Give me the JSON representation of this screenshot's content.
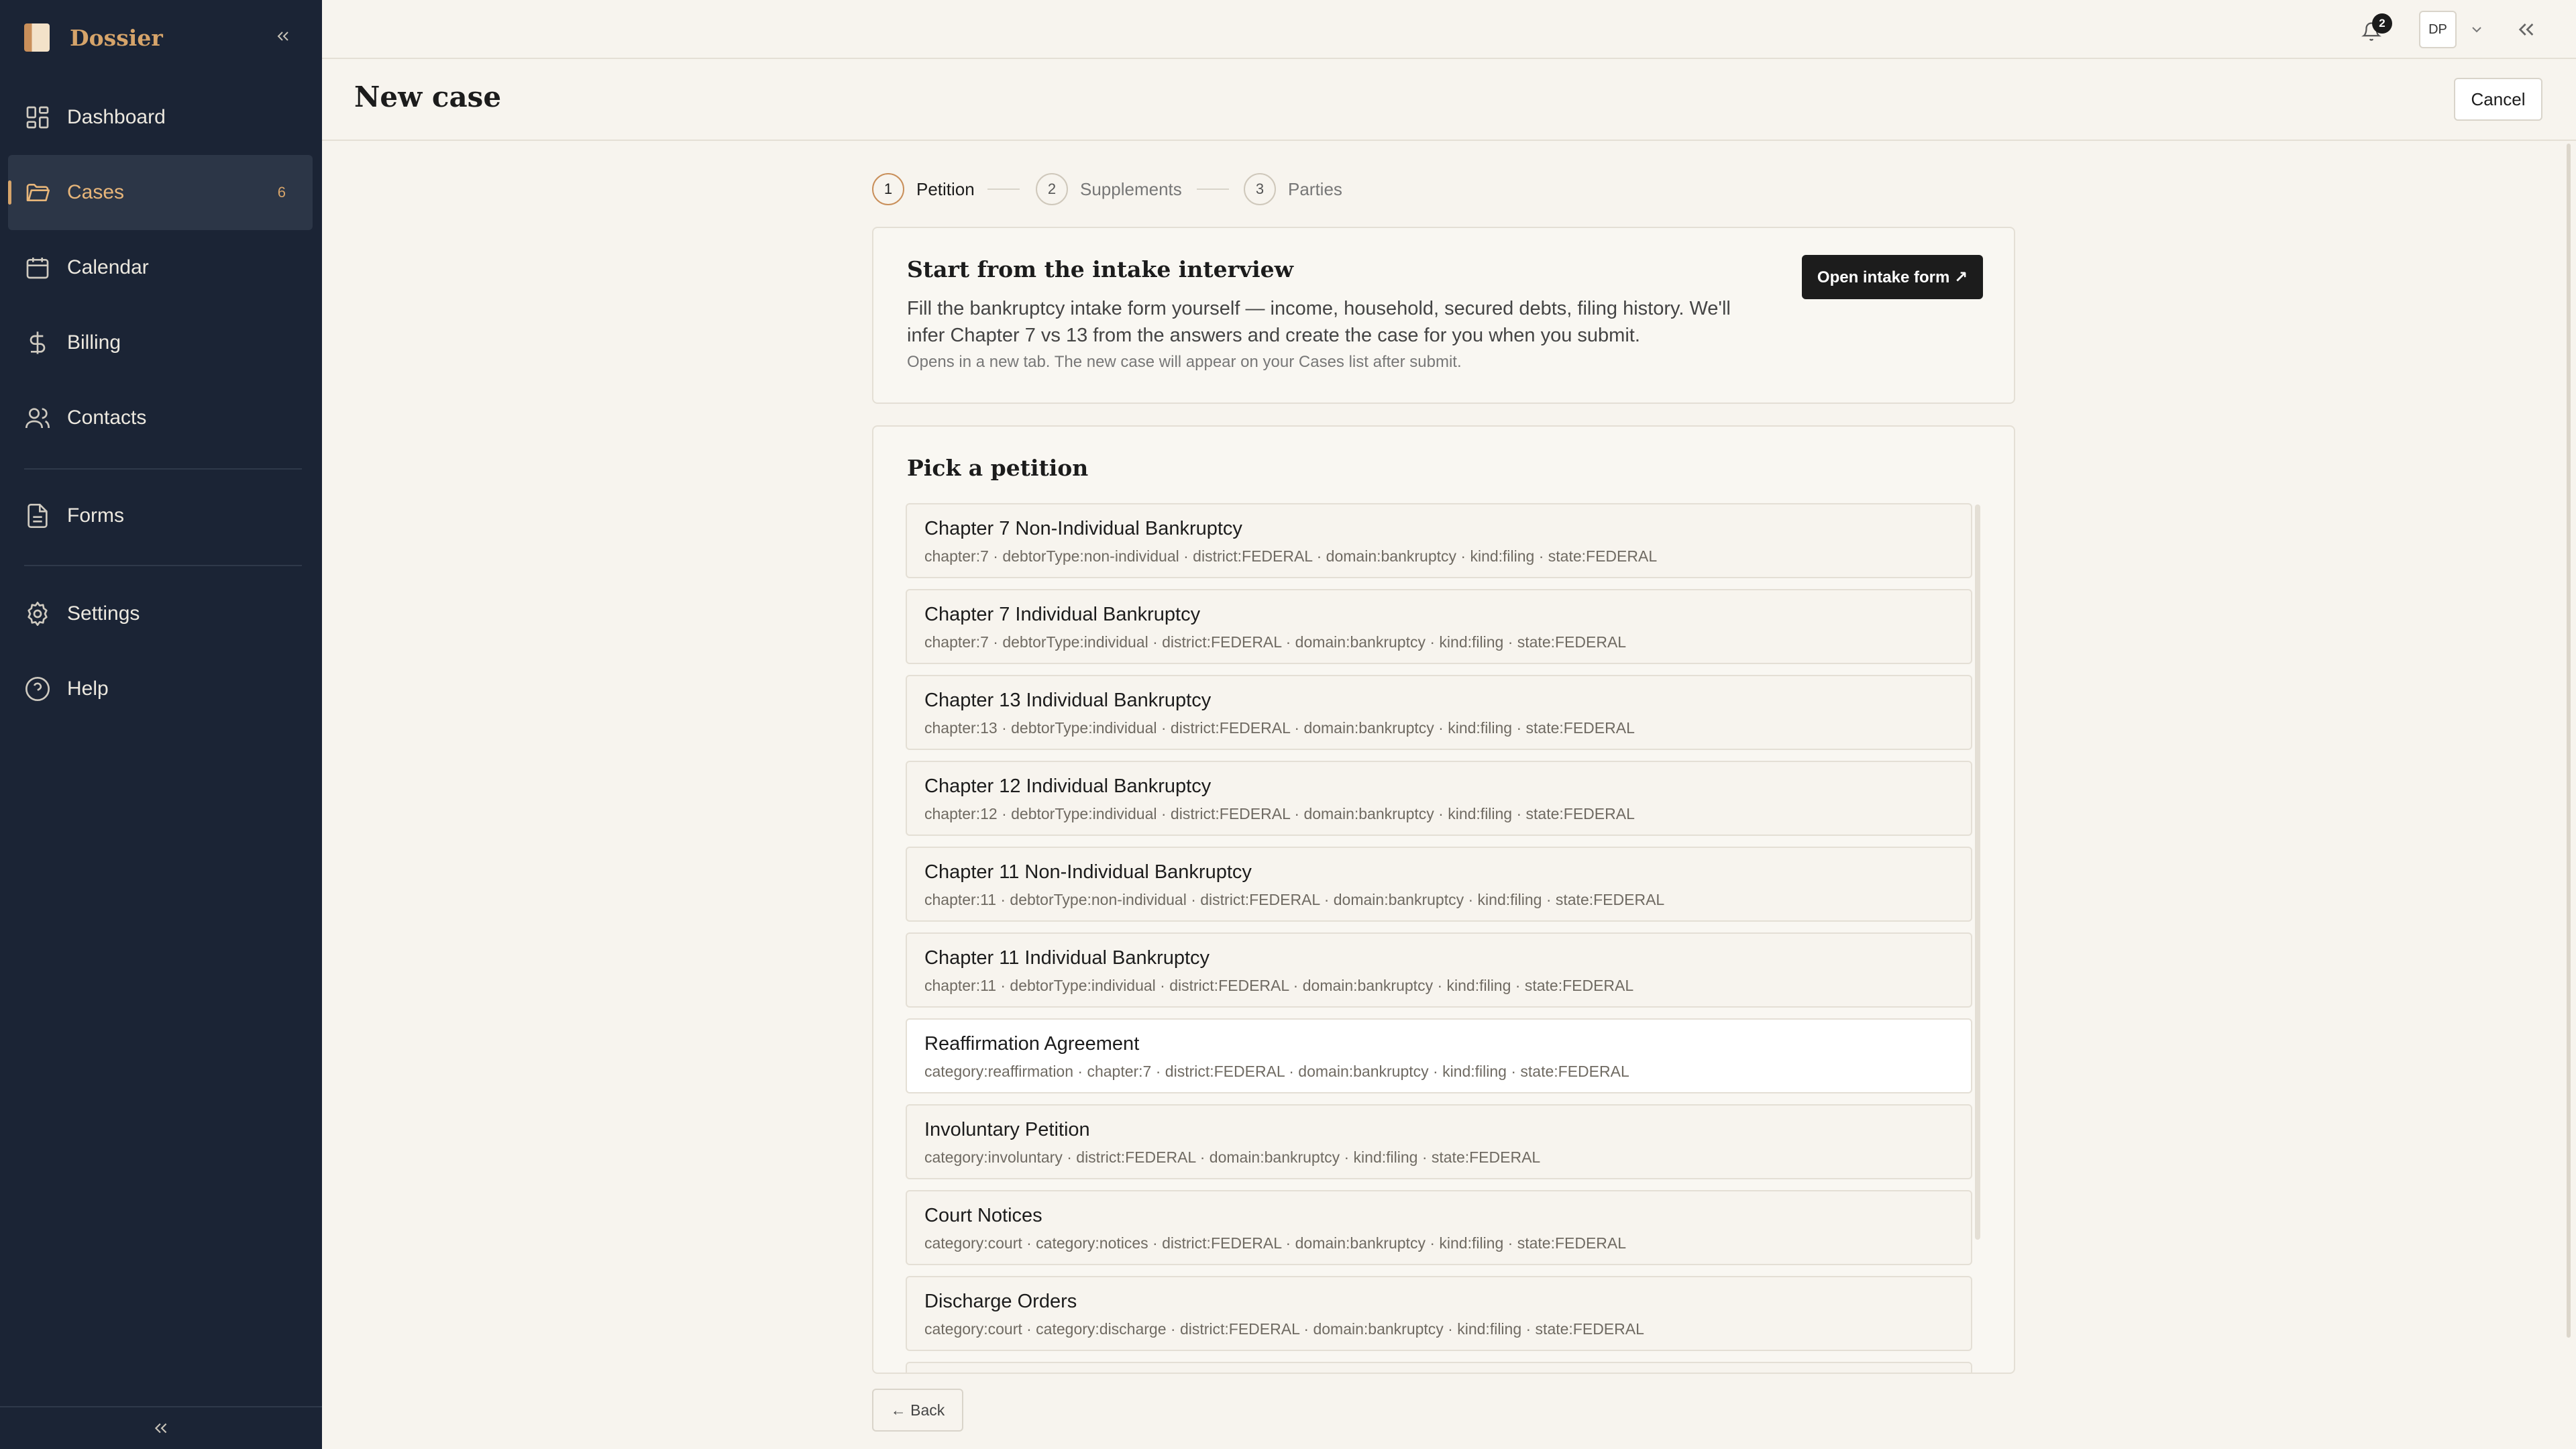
{
  "app": {
    "name": "Dossier"
  },
  "sidebar": {
    "items": [
      {
        "label": "Dashboard",
        "icon": "dashboard-icon"
      },
      {
        "label": "Cases",
        "icon": "folder-icon",
        "badge": "6",
        "active": true
      },
      {
        "label": "Calendar",
        "icon": "calendar-icon"
      },
      {
        "label": "Billing",
        "icon": "dollar-icon"
      },
      {
        "label": "Contacts",
        "icon": "contacts-icon"
      },
      {
        "label": "Forms",
        "icon": "file-icon"
      },
      {
        "label": "Settings",
        "icon": "gear-icon"
      },
      {
        "label": "Help",
        "icon": "help-icon"
      }
    ]
  },
  "topbar": {
    "notification_count": "2",
    "user_initials": "DP"
  },
  "page": {
    "title": "New case",
    "cancel_label": "Cancel"
  },
  "stepper": {
    "steps": [
      {
        "number": "1",
        "label": "Petition",
        "active": true
      },
      {
        "number": "2",
        "label": "Supplements"
      },
      {
        "number": "3",
        "label": "Parties"
      }
    ]
  },
  "intake": {
    "title": "Start from the intake interview",
    "description": "Fill the bankruptcy intake form yourself — income, household, secured debts, filing history. We'll infer Chapter 7 vs 13 from the answers and create the case for you when you submit.",
    "note": "Opens in a new tab. The new case will appear on your Cases list after submit.",
    "button_label": "Open intake form ↗"
  },
  "petitions": {
    "title": "Pick a petition",
    "items": [
      {
        "title": "Chapter 7 Non-Individual Bankruptcy",
        "tags": "chapter:7 · debtorType:non-individual · district:FEDERAL · domain:bankruptcy · kind:filing · state:FEDERAL"
      },
      {
        "title": "Chapter 7 Individual Bankruptcy",
        "tags": "chapter:7 · debtorType:individual · district:FEDERAL · domain:bankruptcy · kind:filing · state:FEDERAL"
      },
      {
        "title": "Chapter 13 Individual Bankruptcy",
        "tags": "chapter:13 · debtorType:individual · district:FEDERAL · domain:bankruptcy · kind:filing · state:FEDERAL"
      },
      {
        "title": "Chapter 12 Individual Bankruptcy",
        "tags": "chapter:12 · debtorType:individual · district:FEDERAL · domain:bankruptcy · kind:filing · state:FEDERAL"
      },
      {
        "title": "Chapter 11 Non-Individual Bankruptcy",
        "tags": "chapter:11 · debtorType:non-individual · district:FEDERAL · domain:bankruptcy · kind:filing · state:FEDERAL"
      },
      {
        "title": "Chapter 11 Individual Bankruptcy",
        "tags": "chapter:11 · debtorType:individual · district:FEDERAL · domain:bankruptcy · kind:filing · state:FEDERAL"
      },
      {
        "title": "Reaffirmation Agreement",
        "tags": "category:reaffirmation · chapter:7 · district:FEDERAL · domain:bankruptcy · kind:filing · state:FEDERAL",
        "highlighted": true
      },
      {
        "title": "Involuntary Petition",
        "tags": "category:involuntary · district:FEDERAL · domain:bankruptcy · kind:filing · state:FEDERAL"
      },
      {
        "title": "Court Notices",
        "tags": "category:court · category:notices · district:FEDERAL · domain:bankruptcy · kind:filing · state:FEDERAL"
      },
      {
        "title": "Discharge Orders",
        "tags": "category:court · category:discharge · district:FEDERAL · domain:bankruptcy · kind:filing · state:FEDERAL"
      }
    ]
  },
  "footer": {
    "back_label": "← Back"
  }
}
